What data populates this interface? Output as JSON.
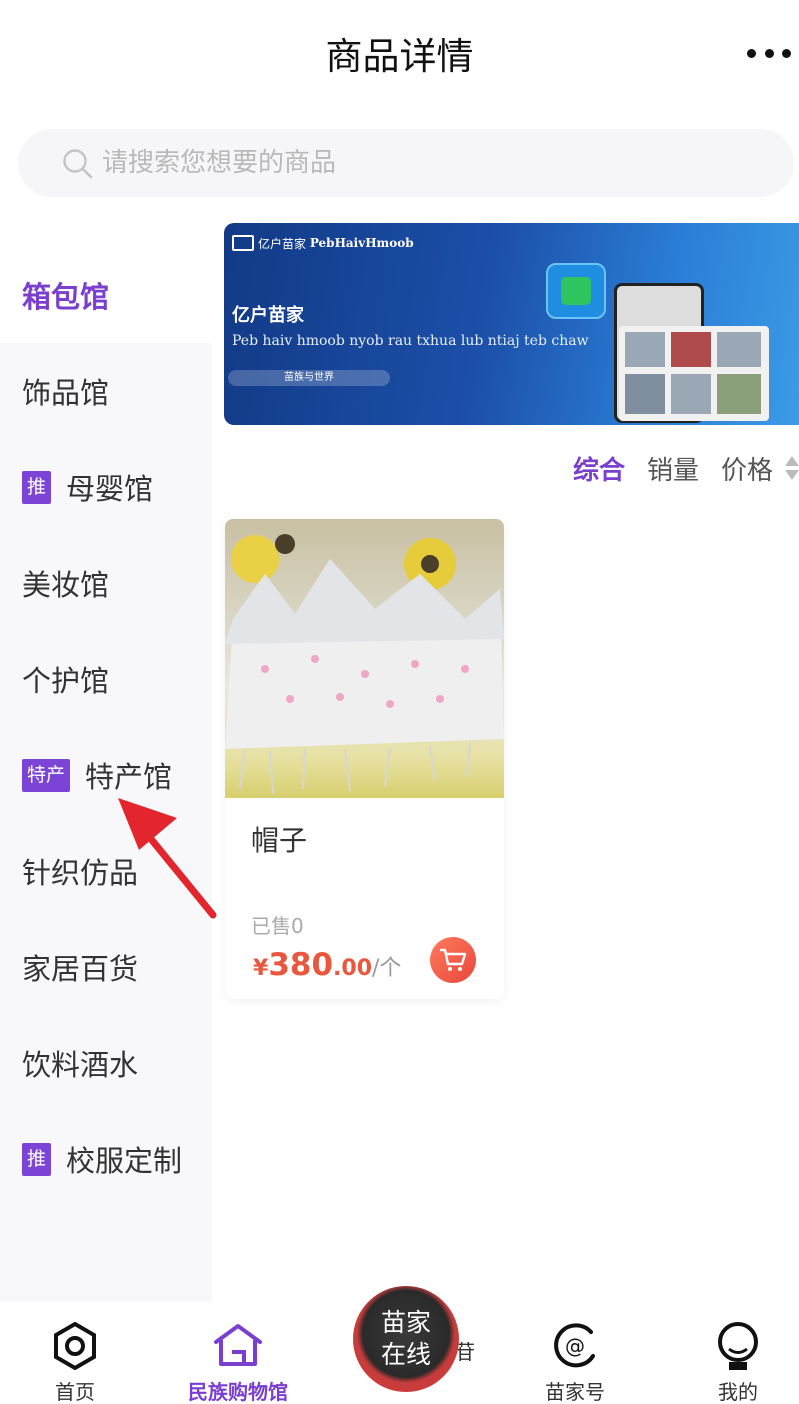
{
  "header": {
    "title": "商品详情",
    "more_icon": "more-dots-icon"
  },
  "search": {
    "placeholder": "请搜索您想要的商品"
  },
  "sidebar": {
    "items": [
      {
        "label": "箱包馆",
        "badge": "",
        "active": true
      },
      {
        "label": "饰品馆",
        "badge": ""
      },
      {
        "label": "母婴馆",
        "badge": "推"
      },
      {
        "label": "美妆馆",
        "badge": ""
      },
      {
        "label": "个护馆",
        "badge": ""
      },
      {
        "label": "特产馆",
        "badge": "特产"
      },
      {
        "label": "针织仿品",
        "badge": ""
      },
      {
        "label": "家居百货",
        "badge": ""
      },
      {
        "label": "饮料酒水",
        "badge": ""
      },
      {
        "label": "校服定制",
        "badge": "推"
      }
    ]
  },
  "banner": {
    "brand_cn": "亿户苗家",
    "brand_en": "PebHaivHmoob",
    "title": "亿户苗家",
    "subtitle": "Peb haiv hmoob nyob rau txhua lub ntiaj teb chaw",
    "pill": "苗族与世界"
  },
  "sort": {
    "items": [
      "综合",
      "销量",
      "价格"
    ],
    "active": "综合"
  },
  "products": [
    {
      "title": "帽子",
      "sold": "已售0",
      "currency": "¥",
      "price_int": "380",
      "price_dec": ".00",
      "unit": "/个"
    }
  ],
  "tabbar": {
    "items": [
      {
        "label": "首页",
        "icon": "home-hexagon-icon"
      },
      {
        "label": "民族购物馆",
        "icon": "shop-house-icon",
        "active": true
      },
      {
        "label": "苗家号",
        "icon": "at-sign-icon"
      },
      {
        "label": "我的",
        "icon": "user-face-icon"
      }
    ],
    "center": {
      "line1": "苗家",
      "line2": "在线"
    },
    "center_cut_text": "苷"
  },
  "colors": {
    "accent": "#7b3fcf",
    "price": "#e9573f",
    "badge": "#7b44d6",
    "annotation": "#e3262d"
  }
}
